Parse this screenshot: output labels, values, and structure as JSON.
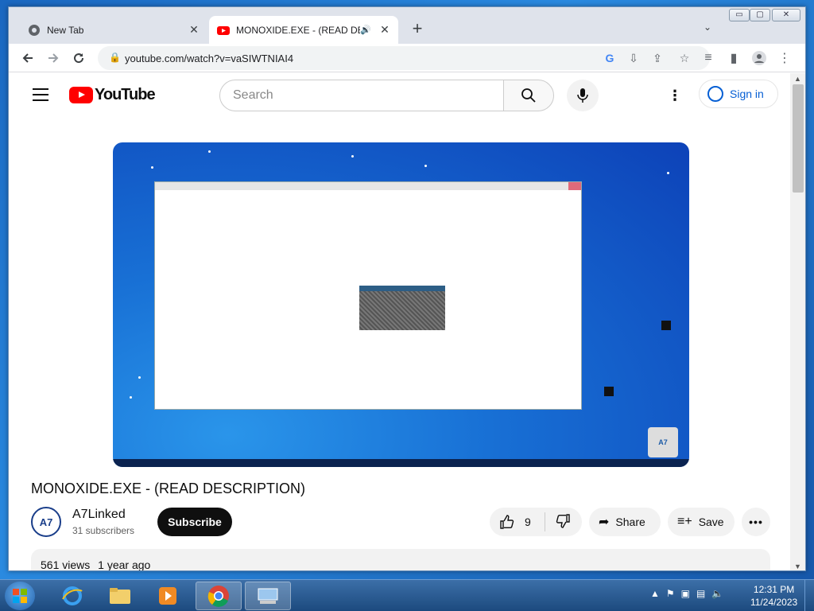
{
  "browser": {
    "tabs": [
      {
        "title": "New Tab",
        "active": false
      },
      {
        "title": "MONOXIDE.EXE - (READ DES",
        "active": true
      }
    ],
    "url": "youtube.com/watch?v=vaSIWTNIAI4",
    "close_glyph": "✕",
    "new_tab_glyph": "+",
    "tab_search_glyph": "⌄",
    "window_controls": {
      "minimize": "▭",
      "maximize": "▢",
      "close": "✕"
    }
  },
  "youtube": {
    "logo_text": "YouTube",
    "search_placeholder": "Search",
    "signin_label": "Sign in",
    "more_glyph": "⋮"
  },
  "video": {
    "title": "MONOXIDE.EXE - (READ DESCRIPTION)",
    "channel_name": "A7Linked",
    "channel_avatar_text": "A7",
    "subscribers": "31 subscribers",
    "subscribe_label": "Subscribe",
    "like_count": "9",
    "share_label": "Share",
    "save_label": "Save",
    "more_actions_glyph": "•••",
    "views": "561 views",
    "age": "1 year ago"
  },
  "taskbar": {
    "time": "12:31 PM",
    "date": "11/24/2023"
  },
  "colors": {
    "accent_red": "#ff0000",
    "link_blue": "#065fd4",
    "taskbar": "#1c4a7e"
  }
}
